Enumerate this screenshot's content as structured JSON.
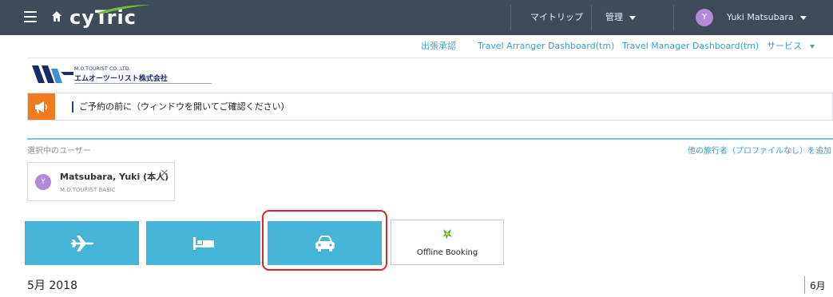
{
  "topbar": {
    "brand": "cyTric",
    "my_trips": "マイトリップ",
    "admin": "管理",
    "user_initial": "Y",
    "user_name": "Yuki Matsubara"
  },
  "subnav": {
    "approval": "出張承認",
    "arranger_dashboard": "Travel Arranger Dashboard(tm)",
    "manager_dashboard": "Travel Manager Dashboard(tm)",
    "services": "サービス"
  },
  "company": {
    "name_en": "M.O.TOURIST CO.,LTD.",
    "name_jp": "エムオーツーリスト株式会社"
  },
  "announcement": {
    "text": "ご予約の前に（ウィンドウを開いてご確認ください）"
  },
  "selected_user": {
    "section_label": "選択中のユーザー",
    "add_traveler_link": "他の旅行者（プロファイルなし）を追加",
    "initial": "Y",
    "name": "Matsubara, Yuki (本人)",
    "profile": "M.O.TOURIST BASIC",
    "close_symbol": "×"
  },
  "booking": {
    "offline_label": "Offline Booking",
    "icons": [
      "airplane-icon",
      "hotel-bed-icon",
      "car-icon",
      "offline-booking-icon"
    ]
  },
  "calendar": {
    "current_month": "5月 2018",
    "next_month": "6月"
  },
  "colors": {
    "topbar_bg": "#3f4b59",
    "accent_blue": "#46b6d8",
    "link_blue": "#3aa0c8",
    "alert_orange": "#f07a1e",
    "avatar_purple": "#b48ad8",
    "highlight_red": "#d9262a"
  }
}
